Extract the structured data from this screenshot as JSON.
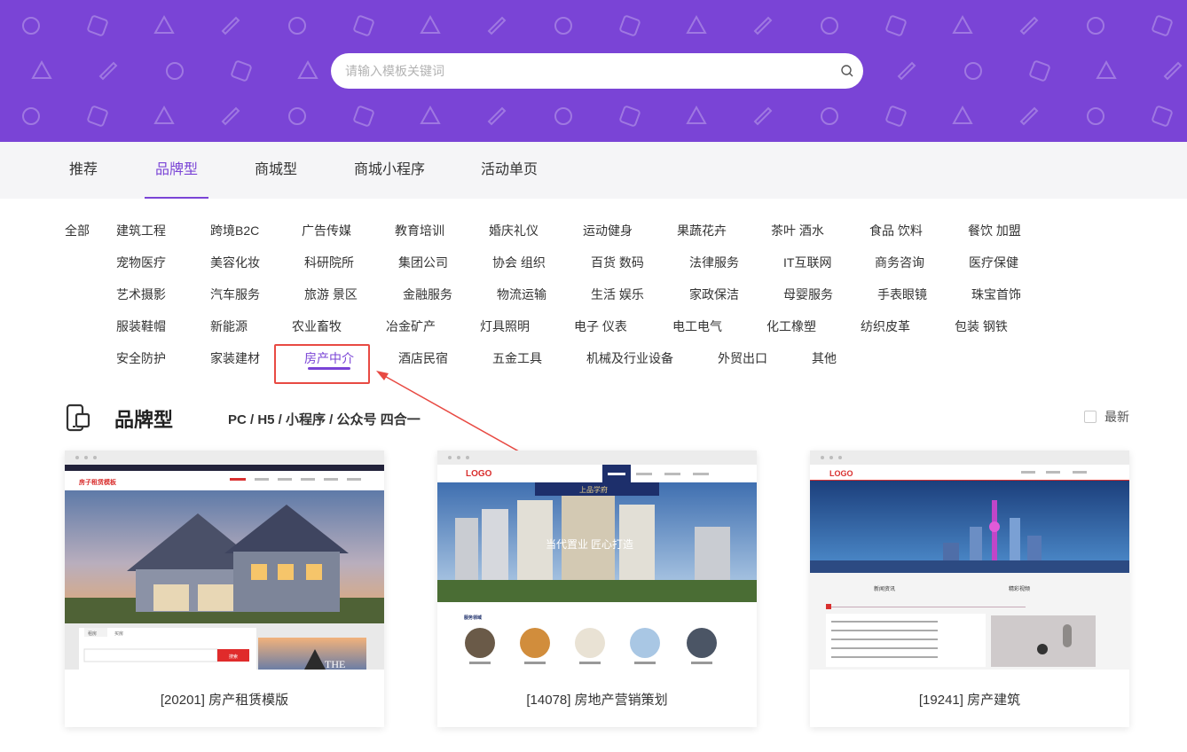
{
  "search": {
    "placeholder": "请输入模板关键词",
    "icon": "search-icon"
  },
  "tabs": [
    {
      "label": "推荐",
      "active": false
    },
    {
      "label": "品牌型",
      "active": true
    },
    {
      "label": "商城型",
      "active": false
    },
    {
      "label": "商城小程序",
      "active": false
    },
    {
      "label": "活动单页",
      "active": false
    }
  ],
  "categories": {
    "all_label": "全部",
    "rows": [
      [
        "建筑工程",
        "跨境B2C",
        "广告传媒",
        "教育培训",
        "婚庆礼仪",
        "运动健身",
        "果蔬花卉",
        "茶叶 酒水",
        "食品 饮料",
        "餐饮 加盟"
      ],
      [
        "宠物医疗",
        "美容化妆",
        "科研院所",
        "集团公司",
        "协会 组织",
        "百货 数码",
        "法律服务",
        "IT互联网",
        "商务咨询",
        "医疗保健"
      ],
      [
        "艺术摄影",
        "汽车服务",
        "旅游 景区",
        "金融服务",
        "物流运输",
        "生活 娱乐",
        "家政保洁",
        "母婴服务",
        "手表眼镜",
        "珠宝首饰"
      ],
      [
        "服装鞋帽",
        "新能源",
        "农业畜牧",
        "冶金矿产",
        "灯具照明",
        "电子 仪表",
        "电工电气",
        "化工橡塑",
        "纺织皮革",
        "包装 钢铁"
      ],
      [
        "安全防护",
        "家装建材",
        "房产中介",
        "酒店民宿",
        "五金工具",
        "机械及行业设备",
        "外贸出口",
        "其他"
      ]
    ],
    "selected": "房产中介"
  },
  "section": {
    "icon": "devices-icon",
    "title": "品牌型",
    "subtitle": "PC / H5 / 小程序 / 公众号 四合一",
    "latest_label": "最新"
  },
  "cards": [
    {
      "label": "[20201] 房产租赁模版",
      "preview": {
        "logo": "房子租赁模板",
        "search_button": "搜索",
        "tab_a": "租房",
        "tab_b": "买房",
        "promo": "THE"
      }
    },
    {
      "label": "[14078] 房地产营销策划",
      "preview": {
        "logo": "LOGO",
        "banner_tag": "上品学府",
        "slogan": "当代置业 匠心打造",
        "section": "服务领域"
      }
    },
    {
      "label": "[19241] 房产建筑",
      "preview": {
        "logo": "LOGO",
        "news_title": "新闻资讯",
        "video_title": "精彩视频"
      }
    }
  ],
  "colors": {
    "accent": "#7a44d6",
    "hero_bg": "#7a44d6",
    "annotation": "#e84a43"
  }
}
